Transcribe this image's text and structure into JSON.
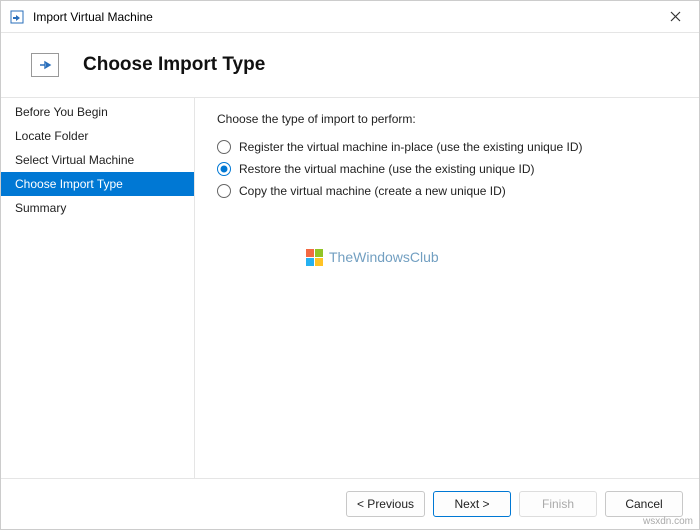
{
  "window": {
    "title": "Import Virtual Machine"
  },
  "header": {
    "title": "Choose Import Type"
  },
  "sidebar": {
    "items": [
      {
        "label": "Before You Begin",
        "selected": false
      },
      {
        "label": "Locate Folder",
        "selected": false
      },
      {
        "label": "Select Virtual Machine",
        "selected": false
      },
      {
        "label": "Choose Import Type",
        "selected": true
      },
      {
        "label": "Summary",
        "selected": false
      }
    ]
  },
  "content": {
    "prompt": "Choose the type of import to perform:",
    "options": [
      {
        "label": "Register the virtual machine in-place (use the existing unique ID)",
        "checked": false
      },
      {
        "label": "Restore the virtual machine (use the existing unique ID)",
        "checked": true
      },
      {
        "label": "Copy the virtual machine (create a new unique ID)",
        "checked": false
      }
    ]
  },
  "watermark": {
    "text": "TheWindowsClub"
  },
  "footer": {
    "previous": "< Previous",
    "next": "Next >",
    "finish": "Finish",
    "cancel": "Cancel"
  },
  "source": "wsxdn.com"
}
